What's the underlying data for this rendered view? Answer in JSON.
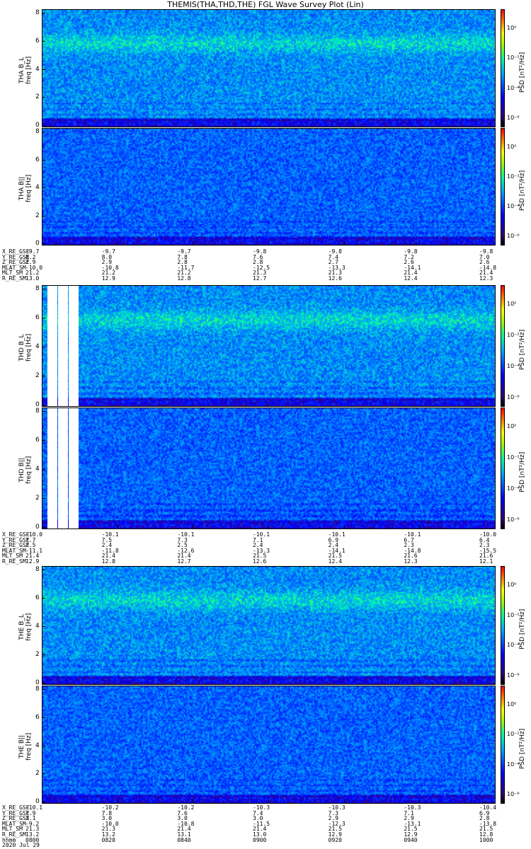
{
  "title": "THEMIS(THA,THD,THE) FGL Wave Survey Plot (Lin)",
  "colors": {
    "low": "#000000",
    "mid": "#00a0ff",
    "high": "#ff0000"
  },
  "chart_data": [
    {
      "type": "heatmap",
      "title": "",
      "ylabel": "THA B_L\nfreq [Hz]",
      "probe": "THA",
      "component": "B_L",
      "ylim": [
        0,
        8
      ],
      "yticks": [
        "0",
        "2",
        "4",
        "6",
        "8"
      ],
      "colorbar_label": "PSD [nT²/Hz]",
      "colorbar_ticks": [
        "10⁰",
        "10⁻²",
        "10⁻⁴",
        "10⁻⁶"
      ],
      "colorbar_scale": "log"
    },
    {
      "type": "heatmap",
      "title": "",
      "ylabel": "THA B||\nfreq [Hz]",
      "probe": "THA",
      "component": "B||",
      "ylim": [
        0,
        8
      ],
      "yticks": [
        "0",
        "2",
        "4",
        "6",
        "8"
      ],
      "colorbar_label": "PSD [nT²/Hz]",
      "colorbar_ticks": [
        "10⁰",
        "10⁻²",
        "10⁻⁴",
        "10⁻⁶"
      ],
      "colorbar_scale": "log"
    },
    {
      "type": "heatmap",
      "title": "",
      "ylabel": "THD B_L\nfreq [Hz]",
      "probe": "THD",
      "component": "B_L",
      "ylim": [
        0,
        8
      ],
      "yticks": [
        "0",
        "2",
        "4",
        "6",
        "8"
      ],
      "colorbar_label": "PSD [nT²/Hz]",
      "colorbar_ticks": [
        "10⁰",
        "10⁻²",
        "10⁻⁴",
        "10⁻⁶"
      ],
      "colorbar_scale": "log"
    },
    {
      "type": "heatmap",
      "title": "",
      "ylabel": "THD B||\nfreq [Hz]",
      "probe": "THD",
      "component": "B||",
      "ylim": [
        0,
        8
      ],
      "yticks": [
        "0",
        "2",
        "4",
        "6",
        "8"
      ],
      "colorbar_label": "PSD [nT²/Hz]",
      "colorbar_ticks": [
        "10⁰",
        "10⁻²",
        "10⁻⁴",
        "10⁻⁶"
      ],
      "colorbar_scale": "log"
    },
    {
      "type": "heatmap",
      "title": "",
      "ylabel": "THE B_L\nfreq [Hz]",
      "probe": "THE",
      "component": "B_L",
      "ylim": [
        0,
        8
      ],
      "yticks": [
        "0",
        "2",
        "4",
        "6",
        "8"
      ],
      "colorbar_label": "PSD [nT²/Hz]",
      "colorbar_ticks": [
        "10⁰",
        "10⁻²",
        "10⁻⁴",
        "10⁻⁶"
      ],
      "colorbar_scale": "log"
    },
    {
      "type": "heatmap",
      "title": "",
      "ylabel": "THE B||\nfreq [Hz]",
      "probe": "THE",
      "component": "B||",
      "ylim": [
        0,
        8
      ],
      "yticks": [
        "0",
        "2",
        "4",
        "6",
        "8"
      ],
      "colorbar_label": "PSD [nT²/Hz]",
      "colorbar_ticks": [
        "10⁰",
        "10⁻²",
        "10⁻⁴",
        "10⁻⁶"
      ],
      "colorbar_scale": "log"
    }
  ],
  "ephemeris": [
    {
      "labels": [
        "X_RE_GSE",
        "Y_RE_GSE",
        "Z_RE_GSE",
        "MLAT_SM",
        "MLT_SM",
        "R_RE_SM"
      ],
      "columns": [
        [
          "-9.7",
          "8.2",
          "2.9",
          "-10.0",
          "21.2",
          "13.0"
        ],
        [
          "-9.7",
          "8.0",
          "2.9",
          "-10.8",
          "21.2",
          "12.9"
        ],
        [
          "-9.7",
          "7.8",
          "2.8",
          "-11.7",
          "21.2",
          "12.8"
        ],
        [
          "-9.8",
          "7.6",
          "2.8",
          "-12.5",
          "21.3",
          "12.7"
        ],
        [
          "-9.8",
          "7.4",
          "2.7",
          "-13.3",
          "21.3",
          "12.6"
        ],
        [
          "-9.8",
          "7.2",
          "2.6",
          "-14.1",
          "21.4",
          "12.4"
        ],
        [
          "-9.8",
          "7.0",
          "2.6",
          "-14.8",
          "21.4",
          "12.3"
        ]
      ]
    },
    {
      "labels": [
        "X_RE_GSE",
        "Y_RE_GSE",
        "Z_RE_GSE",
        "MLAT_SM",
        "MLT_SM",
        "R_RE_SM"
      ],
      "columns": [
        [
          "-10.0",
          "7.7",
          "2.5",
          "-11.1",
          "21.4",
          "12.9"
        ],
        [
          "-10.1",
          "7.5",
          "2.4",
          "-11.8",
          "21.4",
          "12.8"
        ],
        [
          "-10.1",
          "7.3",
          "2.5",
          "-12.6",
          "21.4",
          "12.7"
        ],
        [
          "-10.1",
          "7.1",
          "2.4",
          "-13.3",
          "21.5",
          "12.6"
        ],
        [
          "-10.1",
          "6.9",
          "2.4",
          "-14.1",
          "21.5",
          "12.4"
        ],
        [
          "-10.1",
          "6.7",
          "2.3",
          "-14.8",
          "21.6",
          "12.3"
        ],
        [
          "-10.0",
          "6.4",
          "2.3",
          "-15.5",
          "21.6",
          "12.1"
        ]
      ]
    },
    {
      "labels": [
        "X_RE_GSE",
        "Y_RE_GSE",
        "Z_RE_GSE",
        "MLAT_SM",
        "MLT_SM",
        "R_RE_SM",
        "hhmm",
        "2020 Jul 29"
      ],
      "columns": [
        [
          "-10.1",
          "7.9",
          "3.1",
          "-9.2",
          "21.3",
          "13.2",
          "0800"
        ],
        [
          "-10.2",
          "7.8",
          "3.0",
          "-10.0",
          "21.3",
          "13.2",
          "0820"
        ],
        [
          "-10.2",
          "7.6",
          "3.0",
          "-10.8",
          "21.4",
          "13.1",
          "0840"
        ],
        [
          "-10.3",
          "7.4",
          "3.0",
          "-11.5",
          "21.4",
          "13.0",
          "0900"
        ],
        [
          "-10.3",
          "7.3",
          "2.9",
          "-12.3",
          "21.5",
          "12.9",
          "0920"
        ],
        [
          "-10.3",
          "7.1",
          "2.9",
          "-13.1",
          "21.5",
          "12.9",
          "0940"
        ],
        [
          "-10.4",
          "6.9",
          "2.8",
          "-13.8",
          "21.5",
          "12.8",
          "1000"
        ]
      ]
    }
  ]
}
